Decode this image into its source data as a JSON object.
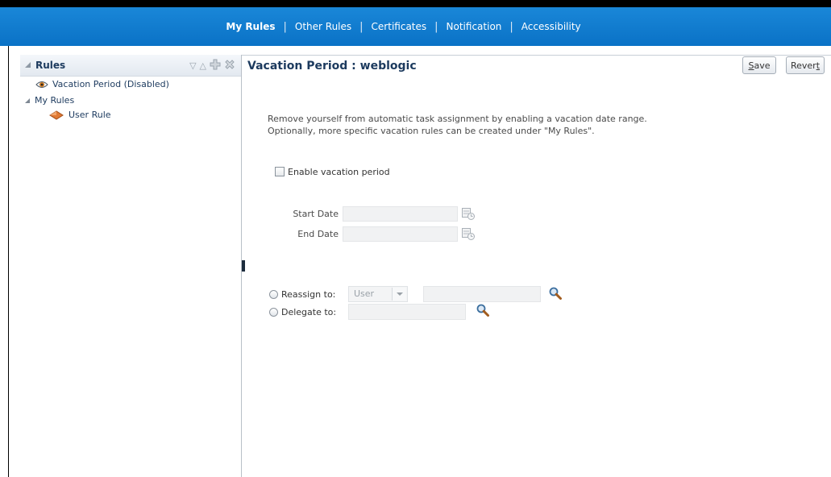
{
  "topnav": {
    "items": [
      "My Rules",
      "Other Rules",
      "Certificates",
      "Notification",
      "Accessibility"
    ],
    "active": "My Rules"
  },
  "left_panel": {
    "title": "Rules",
    "tree": [
      {
        "label": "Vacation Period (Disabled)",
        "icon": "eye-icon"
      },
      {
        "label": "My Rules",
        "icon": "collapse-triangle-icon"
      },
      {
        "label": "User Rule",
        "icon": "rule-diamond-icon"
      }
    ],
    "toolbar_icons": [
      "sort-descending-icon",
      "sort-ascending-icon",
      "add-icon",
      "delete-icon"
    ]
  },
  "main": {
    "title": "Vacation Period : weblogic",
    "save_prefix": "",
    "save_mnemonic": "S",
    "save_rest": "ave",
    "revert_prefix": "Rever",
    "revert_mnemonic": "t",
    "revert_rest": "",
    "description_line1": "Remove yourself from automatic task assignment by enabling a vacation date range.",
    "description_line2": "Optionally, more specific vacation rules can be created under \"My Rules\".",
    "enable_label": "Enable vacation period",
    "start_date_label": "Start Date",
    "end_date_label": "End Date",
    "reassign_label": "Reassign to:",
    "reassign_type": "User",
    "delegate_label": "Delegate to:"
  },
  "colors": {
    "topbar": "#0a72c6",
    "title": "#1c3a5e"
  }
}
